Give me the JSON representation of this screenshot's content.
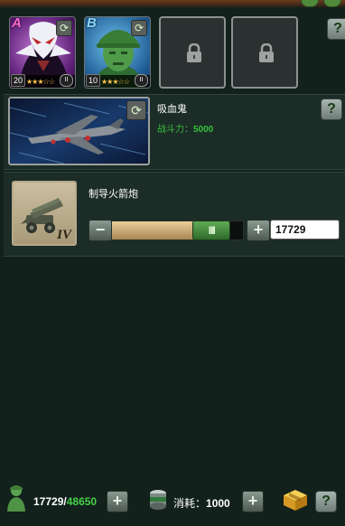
{
  "heroes": [
    {
      "letter": "A",
      "level": "20",
      "rank": "II",
      "stars": "★★★☆☆"
    },
    {
      "letter": "B",
      "level": "10",
      "rank": "II",
      "stars": "★★★☆☆"
    }
  ],
  "help_label": "?",
  "weapon": {
    "name": "吸血鬼",
    "power_label": "战斗力：",
    "power_value": "5000"
  },
  "item": {
    "name": "制导火箭炮",
    "tier": "IV",
    "quantity": "17729",
    "slider_fraction": 0.75,
    "thumb_label": "III",
    "minus_label": "−",
    "plus_label": "+"
  },
  "footer": {
    "supply_current": "17729",
    "supply_separator": "/",
    "supply_max": "48650",
    "cost_label": "消耗：",
    "cost_value": "1000",
    "plus_label": "+"
  },
  "colors": {
    "power": "#36c23a",
    "supply_max": "#47d04a",
    "slider_fill": "#c9a86f"
  }
}
